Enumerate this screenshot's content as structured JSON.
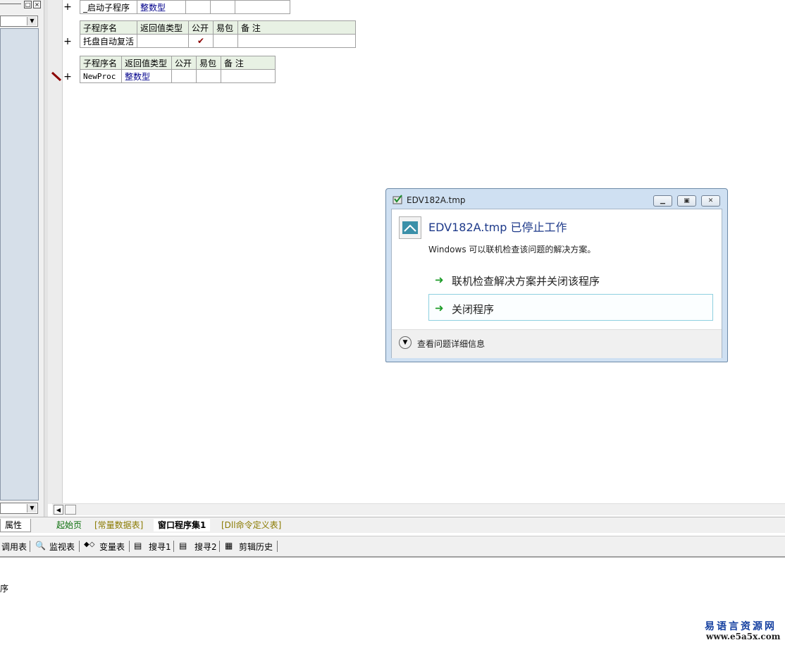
{
  "code": {
    "row1": {
      "name": "_启动子程序",
      "type": "整数型"
    },
    "table2": {
      "headers": [
        "子程序名",
        "返回值类型",
        "公开",
        "易包",
        "备 注"
      ],
      "row": {
        "name": "托盘自动复活",
        "type": "",
        "public": "✔",
        "easy": "",
        "note": ""
      }
    },
    "table3": {
      "headers": [
        "子程序名",
        "返回值类型",
        "公开",
        "易包",
        "备 注"
      ],
      "row": {
        "name": "NewProc",
        "type": "整数型",
        "public": "",
        "easy": "",
        "note": ""
      }
    },
    "plus": "+"
  },
  "tabs": {
    "properties": "属性",
    "items": [
      "起始页",
      "[常量数据表]",
      "窗口程序集1",
      "[Dll命令定义表]"
    ]
  },
  "toolbar": {
    "items": [
      "调用表",
      "监视表",
      "变量表",
      "搜寻1",
      "搜寻2",
      "剪辑历史"
    ]
  },
  "output": {
    "text": "序"
  },
  "brand": {
    "name": "易语言资源网",
    "url": "www.e5a5x.com"
  },
  "dialog": {
    "title": "EDV182A.tmp",
    "heading": "EDV182A.tmp 已停止工作",
    "subtitle": "Windows 可以联机检查该问题的解决方案。",
    "option1": "联机检查解决方案并关闭该程序",
    "option2": "关闭程序",
    "details": "查看问题详细信息",
    "colors": {
      "accent": "#1e3a8a",
      "arrow": "#1c9c28"
    }
  }
}
